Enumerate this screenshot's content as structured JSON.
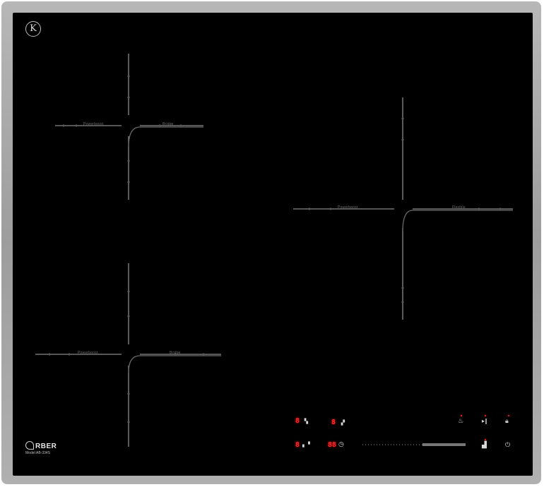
{
  "brand": {
    "logo_glyph": "K",
    "name": "RBER",
    "model": "Model:AB-334S"
  },
  "zones": [
    {
      "label_left": "Powerboost",
      "label_right": "Bridge"
    },
    {
      "label_left": "Powerboost",
      "label_right": "Bridge"
    },
    {
      "label_left": "Powerboost",
      "label_right": "Flexible"
    }
  ],
  "controls": {
    "zone_displays": [
      "8",
      "8",
      "8"
    ],
    "timer_display": "88",
    "icons": {
      "zone_left_top": "zone-left-top-icon",
      "zone_center_top": "zone-center-top-icon",
      "zone_left_bottom": "zone-left-bottom-icon",
      "timer": "◷",
      "keep_warm": "keep-warm-icon",
      "pause": "▸‖",
      "lock": "lock-icon",
      "boost": "boost-icon",
      "power": "⏻"
    },
    "slider_level": 0.42
  },
  "colors": {
    "glass": "#000000",
    "frame": "#a8a8a8",
    "display_red": "#ff2a2a"
  }
}
